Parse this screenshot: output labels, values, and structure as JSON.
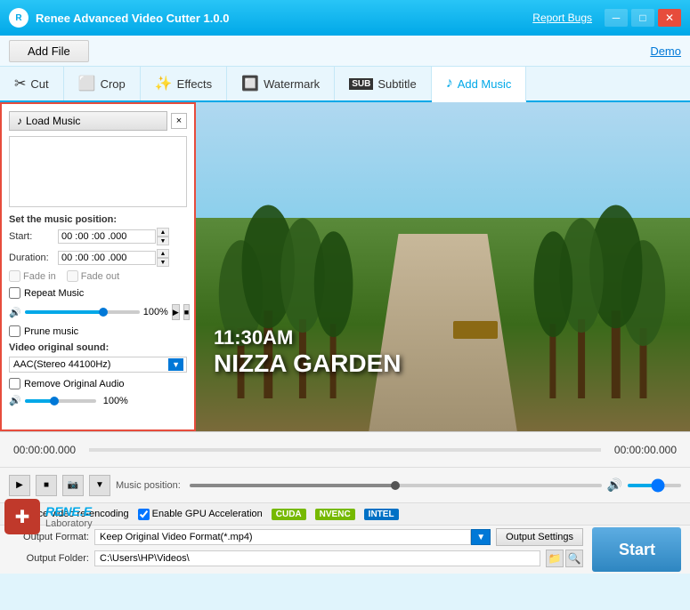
{
  "app": {
    "title": "Renee Advanced Video Cutter 1.0.0",
    "report_bugs": "Report Bugs",
    "demo": "Demo"
  },
  "topbar": {
    "add_file": "Add File"
  },
  "tabs": [
    {
      "id": "cut",
      "label": "Cut",
      "icon": "✂"
    },
    {
      "id": "crop",
      "label": "Crop",
      "icon": "⬜"
    },
    {
      "id": "effects",
      "label": "Effects",
      "icon": "✨"
    },
    {
      "id": "watermark",
      "label": "Watermark",
      "icon": "🔲"
    },
    {
      "id": "subtitle",
      "label": "Subtitle",
      "icon": "SUB"
    },
    {
      "id": "add_music",
      "label": "Add Music",
      "icon": "♪"
    }
  ],
  "left_panel": {
    "load_music": "Load Music",
    "close_btn": "×",
    "set_position": "Set the music position:",
    "start_label": "Start:",
    "start_time": "00 :00 :00 .000",
    "duration_label": "Duration:",
    "duration_time": "00 :00 :00 .000",
    "fade_in": "Fade in",
    "fade_out": "Fade out",
    "repeat_music": "Repeat Music",
    "volume_percent": "100%",
    "prune_music": "Prune music",
    "video_sound_label": "Video original sound:",
    "audio_format": "AAC(Stereo 44100Hz)",
    "remove_original": "Remove Original Audio",
    "volume_percent2": "100%"
  },
  "timeline": {
    "left_time": "00:00:00.000",
    "right_time": "00:00:00.000",
    "music_position": "Music position:"
  },
  "controls": {
    "play": "▶",
    "stop": "■",
    "camera": "📷",
    "volume": "🔊"
  },
  "options": {
    "force_encoding": "Force video re-encoding",
    "gpu_accel": "Enable GPU Acceleration",
    "cuda": "CUDA",
    "nvenc": "NVENC",
    "intel": "INTEL"
  },
  "output": {
    "format_label": "Output Format:",
    "format_value": "Keep Original Video Format(*.mp4)",
    "settings_btn": "Output Settings",
    "folder_label": "Output Folder:",
    "folder_path": "C:\\Users\\HP\\Videos\\"
  },
  "start_btn": "Start",
  "video": {
    "time_text": "11:30AM",
    "location_text": "NIZZA GARDEN"
  },
  "logo": {
    "name": "RENE.E",
    "sub": "Laboratory"
  }
}
